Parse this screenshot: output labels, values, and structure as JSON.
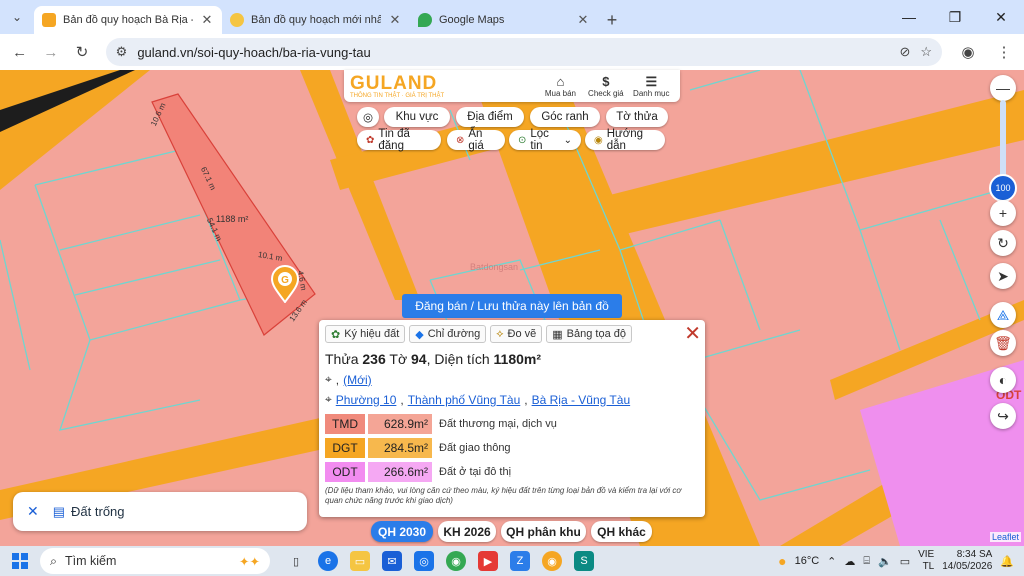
{
  "browser": {
    "tabs": [
      {
        "title": "Bản đồ quy hoạch Bà Rịa - Vũng",
        "active": true,
        "fav_color": "#f5a623"
      },
      {
        "title": "Bản đồ quy hoạch mới nhất Thủ",
        "active": false,
        "fav_color": "#f5c542"
      },
      {
        "title": "Google Maps",
        "active": false,
        "fav_color": "#34a853"
      }
    ],
    "url": "guland.vn/soi-quy-hoach/ba-ria-vung-tau"
  },
  "header": {
    "brand": "GULAND",
    "slogan": "THÔNG TIN THẬT · GIÁ TRỊ THẬT",
    "buttons": [
      {
        "icon": "⌂",
        "label": "Mua bán"
      },
      {
        "icon": "$",
        "label": "Check giá"
      },
      {
        "icon": "☰",
        "label": "Danh mục"
      }
    ]
  },
  "toolbar_pills": {
    "row1": [
      "Khu vực",
      "Địa điểm",
      "Góc ranh",
      "Tờ thửa"
    ],
    "row2": [
      "Tin đã đăng",
      "Ẩn giá",
      "Lọc tin",
      "Hướng dẫn"
    ]
  },
  "parcel_labels": {
    "area": "1188 m²",
    "top": "10.6 m",
    "side_a": "67.1 m",
    "side_b": "54.1 m",
    "side_c": "10.1 m",
    "side_d": "4.6 m",
    "side_e": "13.6 m"
  },
  "watermark": "Batdongsan",
  "post_button": "Đăng bán / Lưu thửa này lên bản đồ",
  "popup": {
    "buttons": [
      "Ký hiệu đất",
      "Chỉ đường",
      "Đo vẽ",
      "Bảng tọa độ"
    ],
    "title_prefix": "Thửa ",
    "parcel_no": "236",
    "sheet_prefix": " Tờ ",
    "sheet_no": "94",
    "area_prefix": ", Diện tích ",
    "area": "1180m²",
    "address_comma": ",",
    "address_new": "(Mới)",
    "ward": "Phường 10",
    "city": "Thành phố Vũng Tàu",
    "province": "Bà Rịa - Vũng Tàu",
    "zones": [
      {
        "code": "TMD",
        "area": "628.9m²",
        "name": "Đất thương mại, dịch vụ",
        "code_color": "#f08a7c",
        "area_color": "#f4a596"
      },
      {
        "code": "DGT",
        "area": "284.5m²",
        "name": "Đất giao thông",
        "code_color": "#f5a623",
        "area_color": "#f7b84d"
      },
      {
        "code": "ODT",
        "area": "266.6m²",
        "name": "Đất ở tại đô thị",
        "code_color": "#f28cf0",
        "area_color": "#f5a8f3"
      }
    ],
    "note": "(Dữ liệu tham khảo, vui lòng căn cứ theo màu, ký hiệu đất trên từng loại bản đồ và kiểm tra lại với cơ quan chức năng trước khi giao dịch)"
  },
  "left_panel": {
    "label": "Đất trống"
  },
  "plan_tabs": [
    {
      "label": "QH 2030",
      "active": true
    },
    {
      "label": "KH 2026",
      "active": false
    },
    {
      "label": "QH phân khu",
      "active": false
    },
    {
      "label": "QH khác",
      "active": false
    }
  ],
  "zoom_value": "100",
  "map_label_odt": "ODT",
  "attribution": "Leaflet",
  "taskbar": {
    "search_placeholder": "Tìm kiếm",
    "temperature": "16°C",
    "lang1": "VIE",
    "lang2": "TL",
    "time": "8:34 SA",
    "date": "14/05/2026"
  }
}
